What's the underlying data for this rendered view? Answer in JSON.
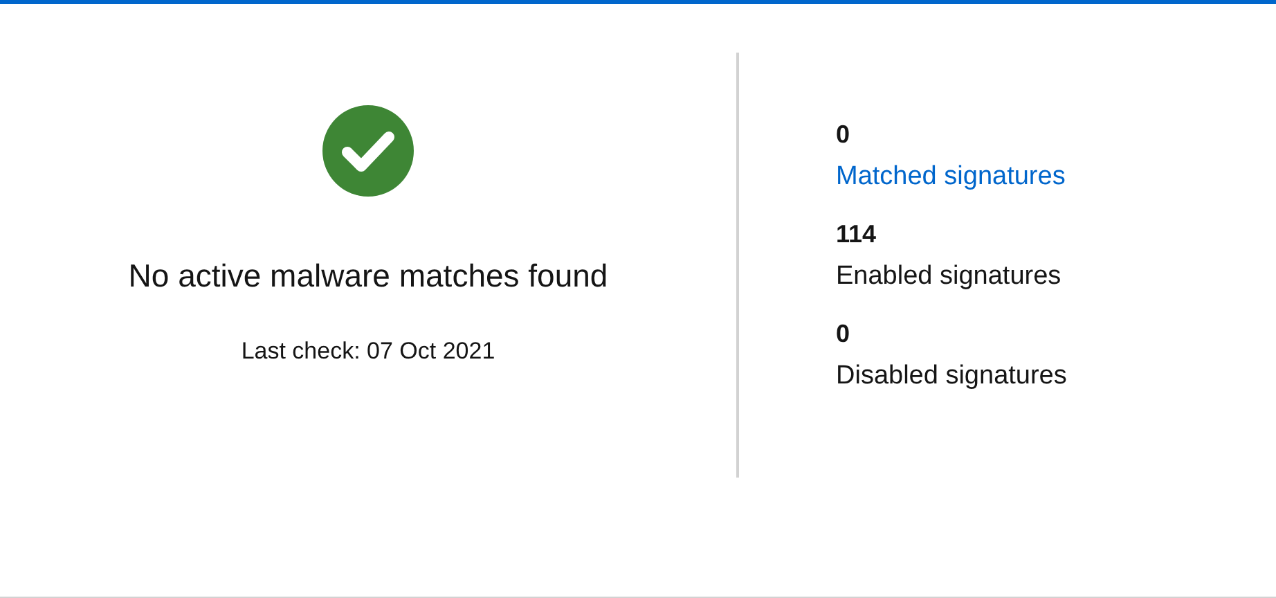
{
  "status": {
    "title": "No active malware matches found",
    "last_check": "Last check: 07 Oct 2021"
  },
  "stats": [
    {
      "value": "0",
      "label": "Matched signatures",
      "kind": "link"
    },
    {
      "value": "114",
      "label": "Enabled signatures",
      "kind": "text"
    },
    {
      "value": "0",
      "label": "Disabled signatures",
      "kind": "text"
    }
  ]
}
